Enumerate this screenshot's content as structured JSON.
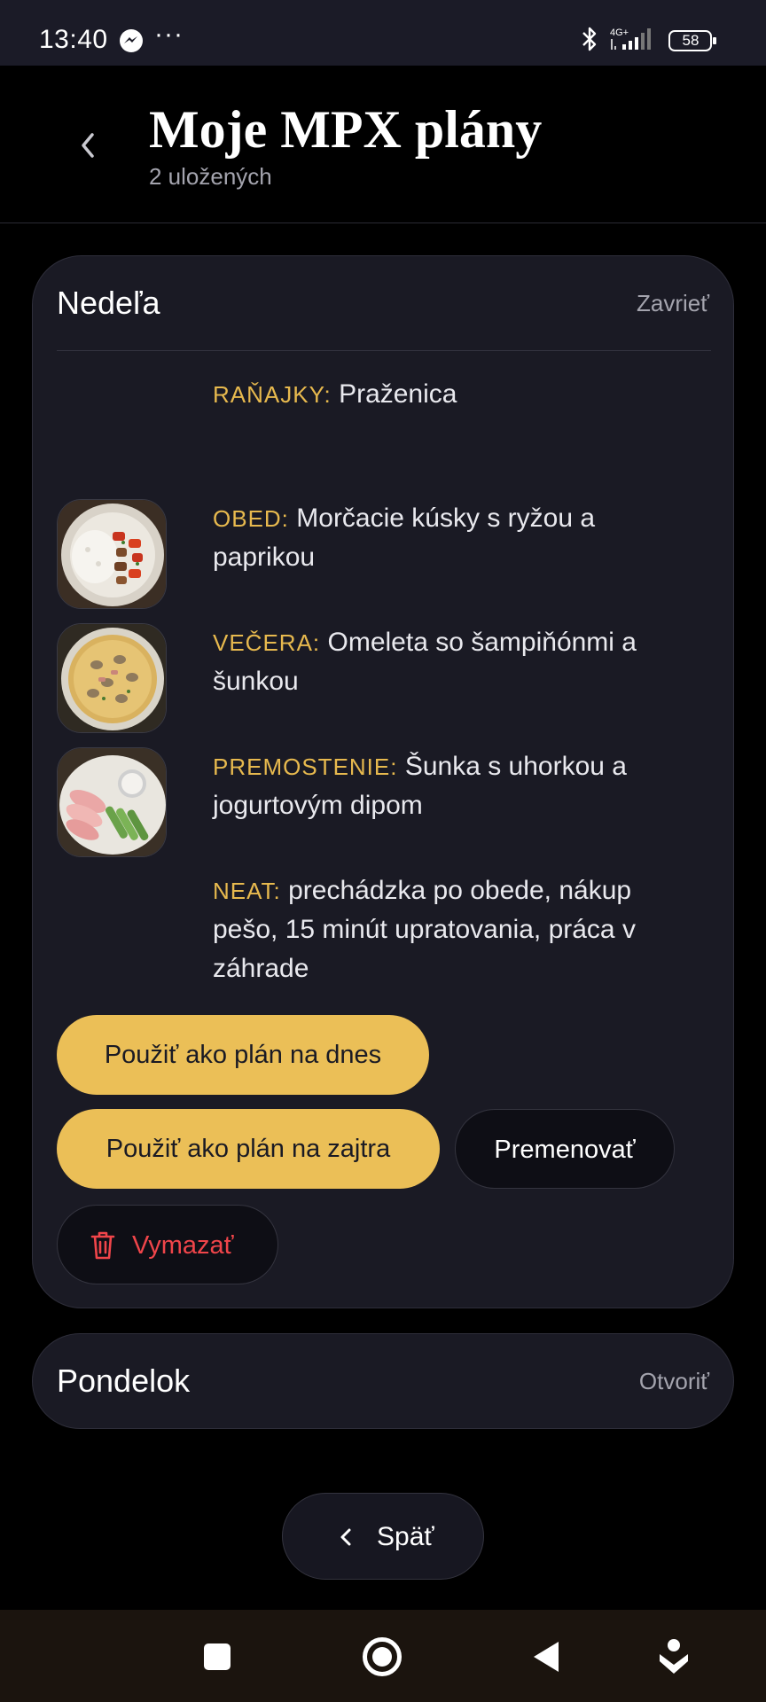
{
  "status_bar": {
    "time": "13:40",
    "dots": "···",
    "network": "4G+",
    "battery": "58",
    "icons": [
      "messenger-icon",
      "bluetooth-icon",
      "signal-icon",
      "battery-icon"
    ]
  },
  "header": {
    "title": "Moje MPX plány",
    "subtitle": "2 uložených"
  },
  "plans": [
    {
      "day": "Nedeľa",
      "action": "Zavrieť",
      "meals": [
        {
          "label": "RAŇAJKY:",
          "text": "Praženica",
          "has_image": false
        },
        {
          "label": "OBED:",
          "text": "Morčacie kúsky s ryžou a paprikou",
          "has_image": true,
          "image": "turkey-rice-pepper"
        },
        {
          "label": "VEČERA:",
          "text": "Omeleta so šampiňónmi a šunkou",
          "has_image": true,
          "image": "mushroom-omelette"
        },
        {
          "label": "PREMOSTENIE:",
          "text": "Šunka s uhorkou a jogurtovým dipom",
          "has_image": true,
          "image": "ham-cucumber-dip"
        },
        {
          "label": "NEAT:",
          "text": "prechádzka po obede, nákup pešo, 15 minút upratovania, práca v záhrade",
          "has_image": false
        }
      ],
      "buttons": {
        "today": "Použiť ako plán na dnes",
        "tomorrow": "Použiť ako plán na zajtra",
        "rename": "Premenovať",
        "delete": "Vymazať"
      }
    },
    {
      "day": "Pondelok",
      "action": "Otvoriť"
    }
  ],
  "footer": {
    "back_label": "Späť"
  },
  "colors": {
    "accent": "#ebbf57",
    "label": "#e7b94e",
    "danger": "#f0454a",
    "card": "#1a1a24"
  }
}
